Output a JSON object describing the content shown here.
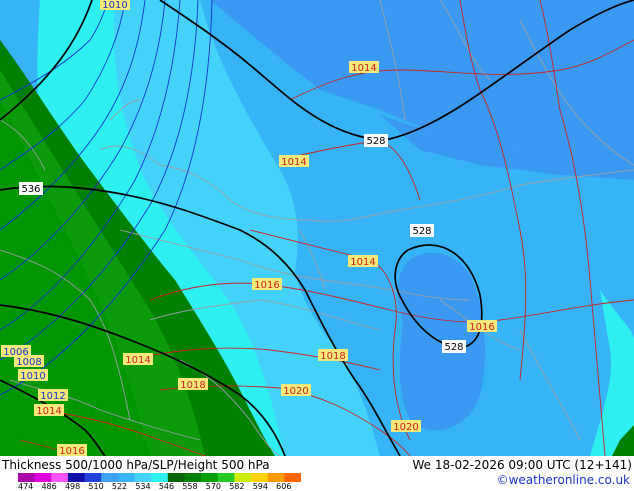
{
  "map": {
    "thickness_labels": [
      "536",
      "528",
      "528",
      "528"
    ],
    "pressure_labels": {
      "blue": [
        "1010",
        "1006",
        "1008",
        "1010",
        "1012"
      ],
      "red": [
        "1014",
        "1014",
        "1014",
        "1016",
        "1016",
        "1018",
        "1018",
        "1020",
        "1020",
        "1014",
        "1014",
        "1016"
      ]
    },
    "colors": {
      "band_474_522": "#3fa3f5",
      "band_dark": "#2f88f0",
      "band_528": "#37b4f7",
      "band_534": "#44d2fa",
      "band_540": "#2ef0f0",
      "band_546": "#008000",
      "band_552": "#00a000",
      "thickness_line": "#000000",
      "isobar_low": "#1833cc",
      "isobar_high": "#cc2222",
      "border_line": "#9aa0a8",
      "label_bg": "#f5e97a"
    }
  },
  "footer": {
    "title": "Thickness 500/1000 hPa/SLP/Height 500 hPa",
    "datetime": "We 18-02-2026 09:00 UTC (12+141)",
    "copyright": "©weatheronline.co.uk",
    "legend": {
      "colors": [
        "#aa00aa",
        "#dd00dd",
        "#ff55ff",
        "#1111aa",
        "#2244dd",
        "#3fa3f5",
        "#37b4f7",
        "#44d2fa",
        "#2ef0f0",
        "#006400",
        "#008000",
        "#00a000",
        "#22cc22",
        "#ccee00",
        "#ffd400",
        "#ff9900",
        "#ff6600"
      ],
      "ticks": [
        "474",
        "486",
        "498",
        "510",
        "522",
        "534",
        "546",
        "558",
        "570",
        "582",
        "594",
        "606"
      ]
    }
  }
}
